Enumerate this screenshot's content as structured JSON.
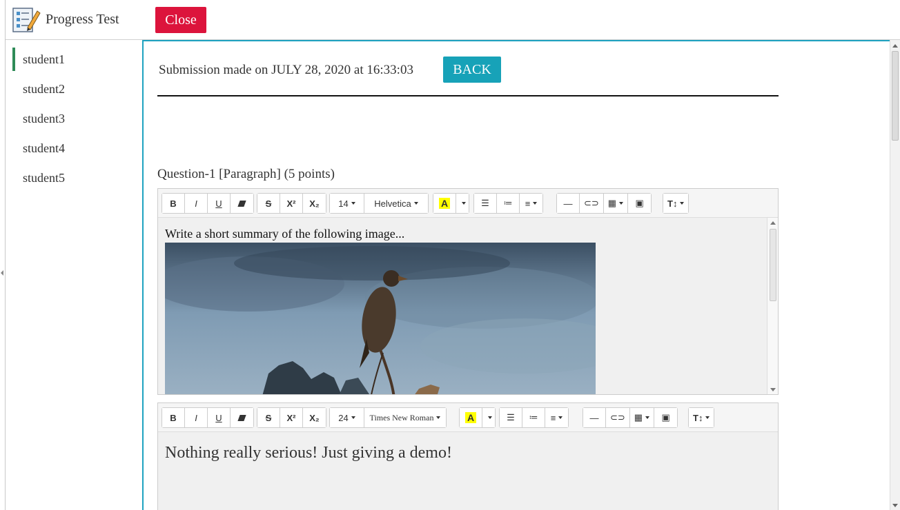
{
  "app": {
    "title": "Progress Test",
    "logo_icon": "checklist-pencil-icon"
  },
  "topbar": {
    "close_label": "Close",
    "close_color": "#dc143c"
  },
  "sidebar": {
    "items": [
      {
        "label": "student1",
        "active": true
      },
      {
        "label": "student2",
        "active": false
      },
      {
        "label": "student3",
        "active": false
      },
      {
        "label": "student4",
        "active": false
      },
      {
        "label": "student5",
        "active": false
      }
    ],
    "active_color": "#2e8b57"
  },
  "main": {
    "submission_text": "Submission made on JULY 28, 2020 at 16:33:03",
    "back_label": "BACK",
    "accent_color": "#17a2b8",
    "question_title": "Question-1  [Paragraph] (5 points)"
  },
  "editor1": {
    "font_size": "14",
    "font_family": "Helvetica",
    "highlight_label": "A",
    "prompt": "Write a short summary of the following image...",
    "image_icon": "cormorant-photo"
  },
  "editor2": {
    "font_size": "24",
    "font_family": "Times New Roman",
    "highlight_label": "A",
    "answer": "Nothing really serious! Just giving a demo!"
  },
  "toolbar": {
    "bold": "B",
    "italic": "I",
    "underline": "U",
    "strike": "S",
    "superscript": "X²",
    "subscript": "X₂",
    "text_height": "T↕"
  }
}
